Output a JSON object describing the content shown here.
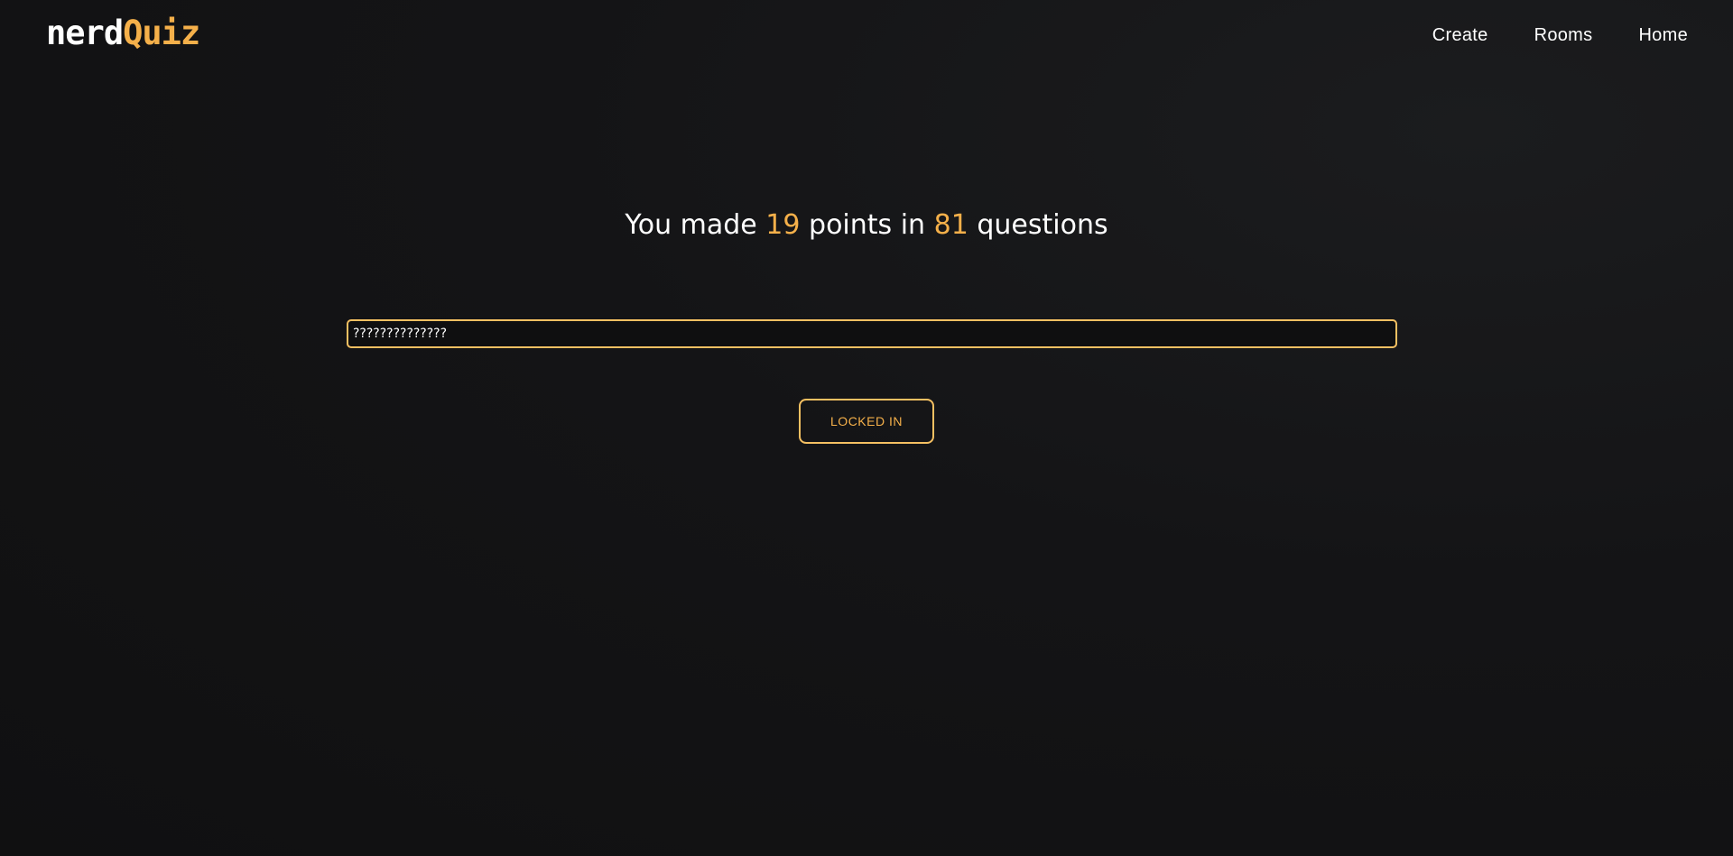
{
  "brand": {
    "logo_part1": "nerd",
    "logo_part2": "Quiz",
    "accent_color": "#f5b04a"
  },
  "nav": {
    "items": [
      {
        "label": "Create"
      },
      {
        "label": "Rooms"
      },
      {
        "label": "Home"
      }
    ]
  },
  "result": {
    "prefix": "You made",
    "points": "19",
    "middle": "points in",
    "questions": "81",
    "suffix": "questions"
  },
  "answer": {
    "value": "??????????????"
  },
  "lock_button": {
    "label": "LOCKED IN"
  }
}
